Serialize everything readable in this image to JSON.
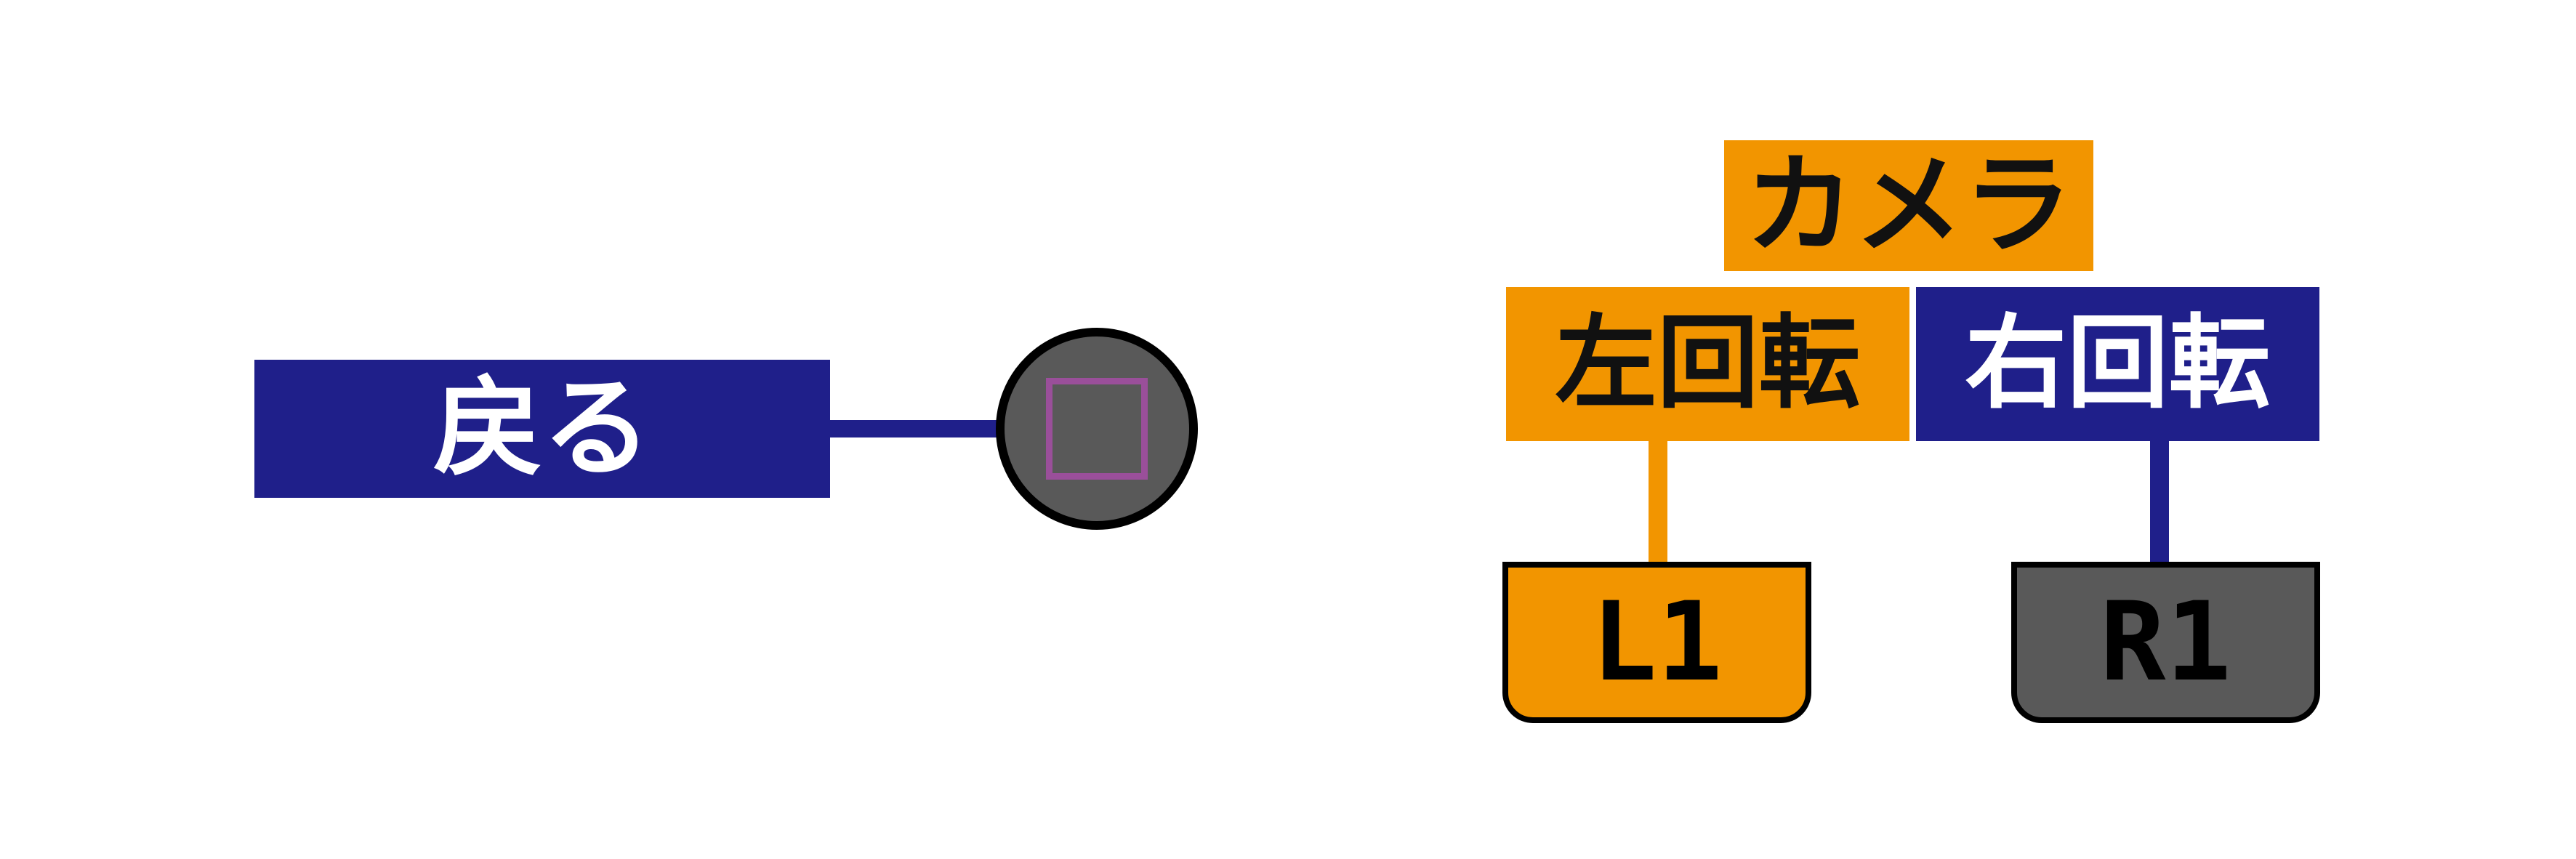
{
  "colors": {
    "navy": "#1f1f8a",
    "orange": "#f29500",
    "button_gray": "#595959",
    "square_symbol": "#9a4f9a"
  },
  "left_group": {
    "label": "戻る",
    "button_icon": "square-icon"
  },
  "right_group": {
    "category_label": "カメラ",
    "rotate_left_label": "左回転",
    "rotate_right_label": "右回転",
    "l1_label": "L1",
    "r1_label": "R1"
  }
}
